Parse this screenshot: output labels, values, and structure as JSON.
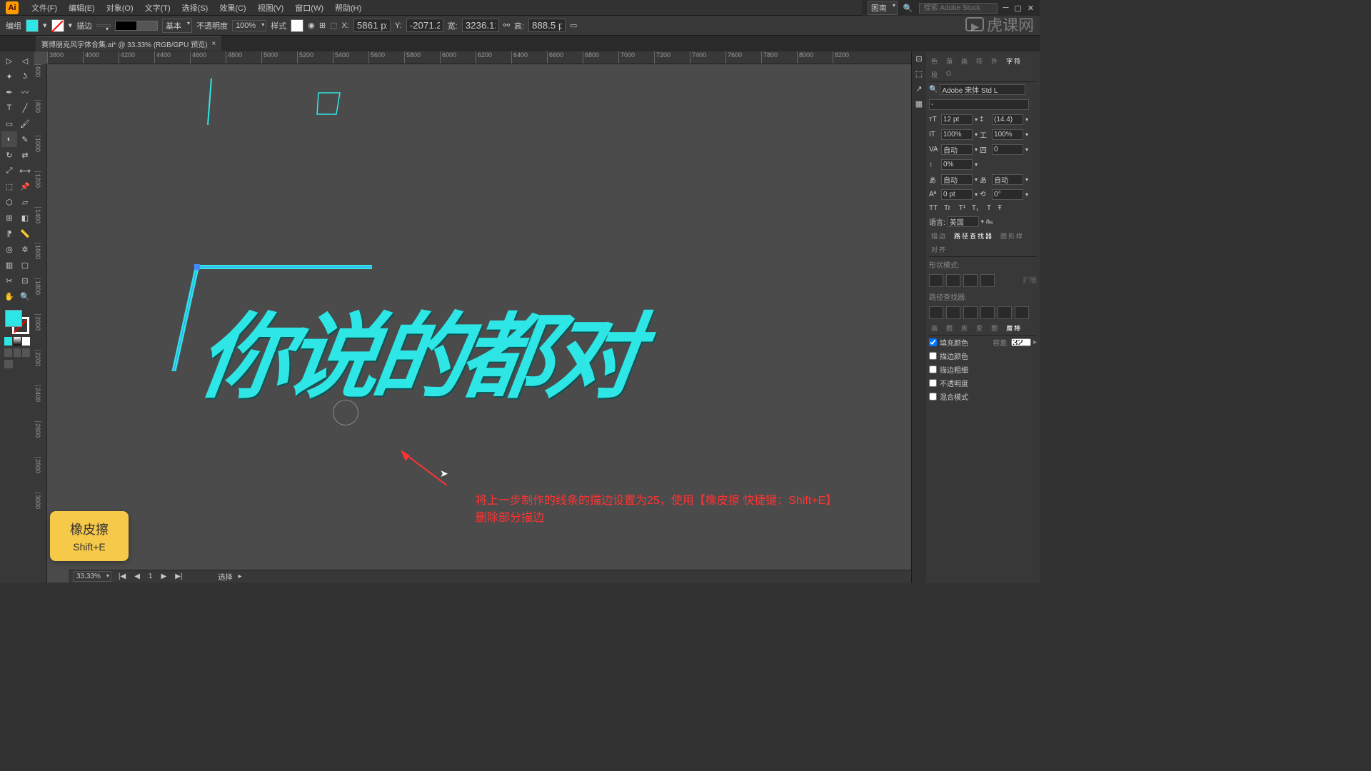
{
  "app": {
    "logo": "Ai"
  },
  "menubar": {
    "items": [
      "文件(F)",
      "编辑(E)",
      "对象(O)",
      "文字(T)",
      "选择(S)",
      "效果(C)",
      "视图(V)",
      "窗口(W)",
      "帮助(H)"
    ]
  },
  "controlbar": {
    "mode_label": "编组",
    "stroke_label": "描边",
    "stroke_weight": "",
    "profile_label": "基本",
    "opacity_label": "不透明度",
    "opacity_value": "100%",
    "style_label": "样式",
    "x_label": "X:",
    "x_value": "5861 px",
    "y_label": "Y:",
    "y_value": "-2071.25",
    "w_label": "宽:",
    "w_value": "3236.127",
    "h_label": "高:",
    "h_value": "888.5 px"
  },
  "topright": {
    "layout_label": "图南",
    "search_placeholder": "搜索 Adobe Stock"
  },
  "tab": {
    "title": "赛博朋克风字体合集.ai* @ 33.33% (RGB/GPU 预览)"
  },
  "ruler_h": [
    "3800",
    "4000",
    "4200",
    "4400",
    "4600",
    "4800",
    "5000",
    "5200",
    "5400",
    "5600",
    "5800",
    "6000",
    "6200",
    "6400",
    "6600",
    "6800",
    "7000",
    "7200",
    "7400",
    "7600",
    "7800",
    "8000",
    "8200"
  ],
  "ruler_v": [
    "600",
    "800",
    "1000",
    "1200",
    "1400",
    "1600",
    "1800",
    "2000",
    "2200",
    "2400",
    "2600",
    "2800",
    "3000"
  ],
  "artwork": {
    "text": "你说的都对"
  },
  "annotations": {
    "yellow_tip_line1": "橡皮擦",
    "yellow_tip_line2": "Shift+E",
    "red_text_line1": "将上一步制作的线条的描边设置为25，使用【橡皮擦 快捷键：Shift+E】",
    "red_text_line2": "删除部分描边"
  },
  "statusbar": {
    "zoom": "33.33%",
    "selection_label": "选择"
  },
  "panels": {
    "top_tabs": [
      "色",
      "渐",
      "画",
      "符",
      "外",
      "字符",
      "段",
      "O"
    ],
    "font_family": "Adobe 宋体 Std L",
    "font_style": "-",
    "font_size": "12 pt",
    "leading": "(14.4)",
    "vscale": "100%",
    "hscale": "100%",
    "kerning": "自动",
    "tracking": "0",
    "baseline_opt": "0%",
    "align1": "自动",
    "align2": "自动",
    "baseline_shift": "0 pt",
    "rotation": "0°",
    "caps": [
      "TT",
      "Tr",
      "T¹",
      "T₁",
      "T",
      "Ŧ"
    ],
    "lang_label": "语言:",
    "lang_value": "美国",
    "aa": "aₐ",
    "mid_tabs": [
      "描边",
      "路径查找器",
      "图形样",
      "对齐"
    ],
    "shape_mode_label": "形状模式:",
    "expand_label": "扩展",
    "pathfinder_label": "路径查找器:",
    "bottom_tabs": [
      "画",
      "图",
      "库",
      "变",
      "图",
      "魔棒"
    ],
    "fill_color_label": "填充颜色",
    "tolerance_label": "容差:",
    "tolerance_value": "32",
    "stroke_color_label": "描边颜色",
    "stroke_weight_label": "描边粗细",
    "opacity_label": "不透明度",
    "blend_mode_label": "混合模式"
  },
  "watermark": "虎课网",
  "colors": {
    "accent": "#2ee6e6",
    "bg_dark": "#323232",
    "bg_mid": "#383838",
    "canvas": "#4b4b4b"
  }
}
